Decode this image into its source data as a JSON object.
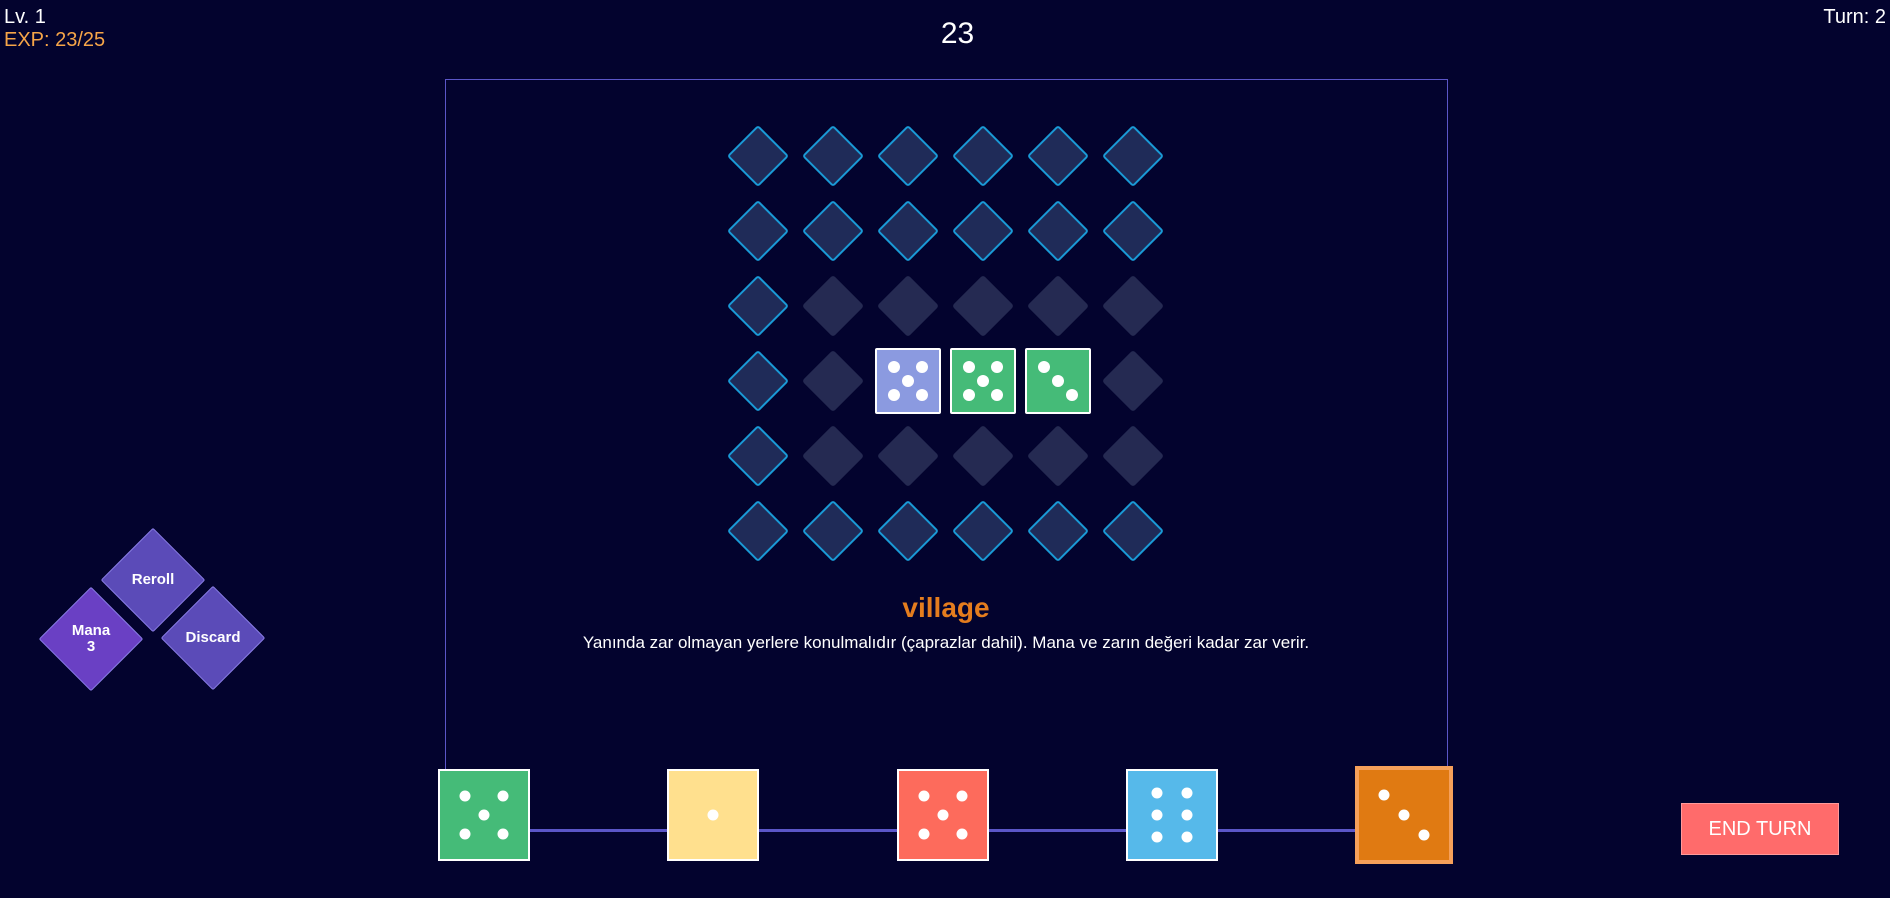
{
  "hud": {
    "level": "Lv. 1",
    "exp": "EXP: 23/25",
    "score": "23",
    "turn": "Turn: 2"
  },
  "board": {
    "rows": [
      [
        "open",
        "open",
        "open",
        "open",
        "open",
        "open"
      ],
      [
        "open",
        "open",
        "open",
        "open",
        "open",
        "open"
      ],
      [
        "open",
        "closed",
        "closed",
        "closed",
        "closed",
        "closed"
      ],
      [
        "open",
        "closed",
        "die",
        "die",
        "die",
        "closed"
      ],
      [
        "open",
        "closed",
        "closed",
        "closed",
        "closed",
        "closed"
      ],
      [
        "open",
        "open",
        "open",
        "open",
        "open",
        "open"
      ]
    ],
    "dice": [
      {
        "row": 3,
        "col": 2,
        "value": 5,
        "color": "#8b9ae0"
      },
      {
        "row": 3,
        "col": 3,
        "value": 5,
        "color": "#45bb78"
      },
      {
        "row": 3,
        "col": 4,
        "value": 3,
        "color": "#45bb78"
      }
    ],
    "colors": {
      "open_fill": "#1f2b58",
      "open_border": "#1a9ad6",
      "closed_fill": "#252a52",
      "frame": "#5b56c8"
    }
  },
  "card": {
    "title": "village",
    "description": "Yanında zar olmayan yerlere konulmalıdır (çaprazlar dahil). Mana ve zarın değeri kadar zar verir.",
    "title_color": "#e57d1e"
  },
  "actions": {
    "reroll": {
      "label": "Reroll",
      "color": "#5b4bb8"
    },
    "mana": {
      "label": "Mana",
      "value": "3",
      "color": "#6a40c4"
    },
    "discard": {
      "label": "Discard",
      "color": "#5b4bb8"
    }
  },
  "hand": [
    {
      "value": 5,
      "color": "#45bb78",
      "selected": false
    },
    {
      "value": 1,
      "color": "#ffe08e",
      "selected": false
    },
    {
      "value": 5,
      "color": "#fd6b5c",
      "selected": false
    },
    {
      "value": 6,
      "color": "#56b9ea",
      "selected": false
    },
    {
      "value": 3,
      "color": "#e07a12",
      "selected": true
    }
  ],
  "end_turn": {
    "label": "END TURN",
    "color": "#ff6b6b"
  }
}
